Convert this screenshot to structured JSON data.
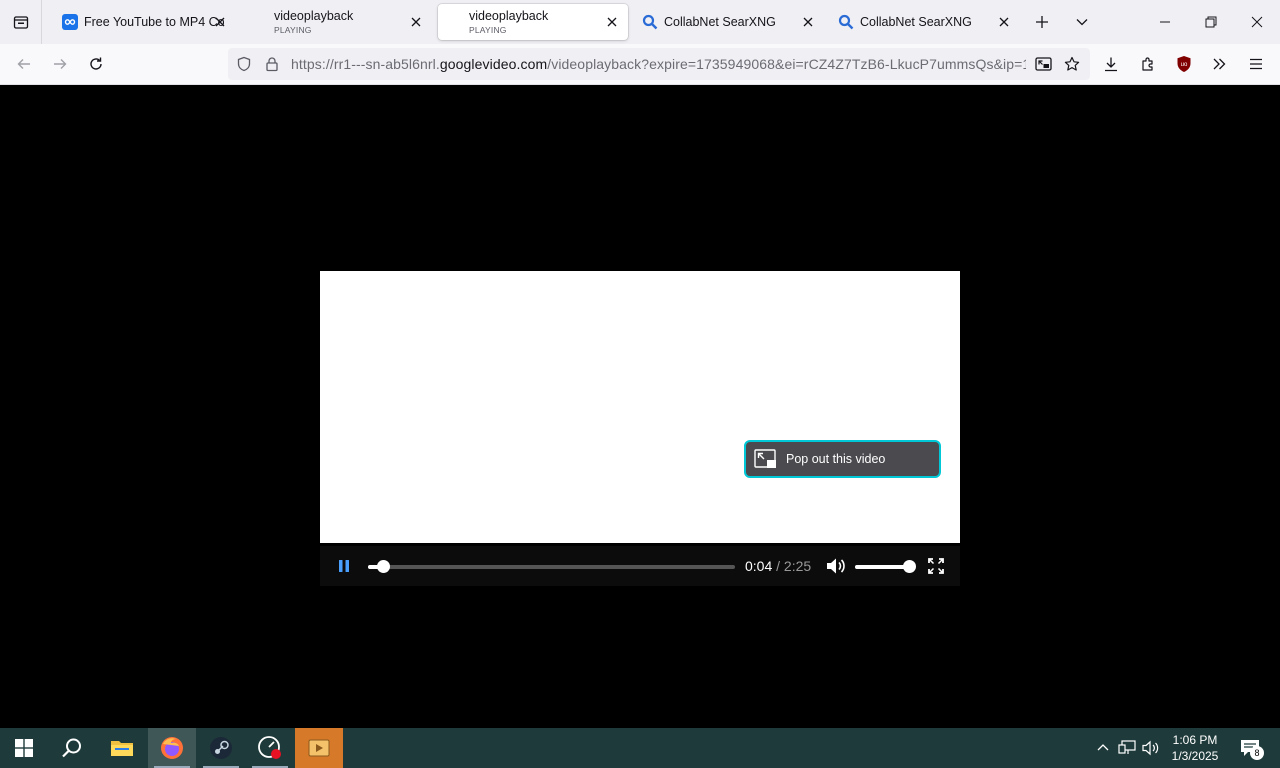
{
  "tabs": [
    {
      "title": "Free YouTube to MP4 Con",
      "subtitle": "",
      "icon": "infinity-favicon-icon"
    },
    {
      "title": "videoplayback",
      "subtitle": "PLAYING",
      "icon": ""
    },
    {
      "title": "videoplayback",
      "subtitle": "PLAYING",
      "icon": "",
      "active": true
    },
    {
      "title": "CollabNet SearXNG",
      "subtitle": "",
      "icon": "search-favicon-icon"
    },
    {
      "title": "CollabNet SearXNG",
      "subtitle": "",
      "icon": "search-favicon-icon"
    }
  ],
  "urlbar": {
    "prefix": "https://rr1---sn-ab5l6nrl.",
    "domain": "googlevideo.com",
    "suffix": "/videoplayback?expire=1735949068&ei=rCZ4Z7TzB6-LkucP7ummsQs&ip=1"
  },
  "video": {
    "pip_label": "Pop out this video",
    "current_time": "0:04",
    "separator": " / ",
    "duration": "2:25",
    "progress_fraction": 0.04,
    "volume_fraction": 1.0
  },
  "taskbar": {
    "time": "1:06 PM",
    "date": "1/3/2025",
    "notification_count": "8"
  },
  "colors": {
    "pip_border": "#00c8d7",
    "taskbar_bg": "#1f3a3a",
    "highlight_app": "#d67a2a"
  }
}
